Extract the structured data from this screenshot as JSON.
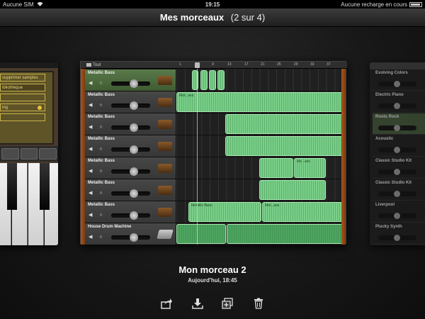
{
  "status_bar": {
    "carrier": "Aucune SIM",
    "time": "19:15",
    "charge": "Aucune recharge en cours"
  },
  "header": {
    "title": "Mes morceaux",
    "count": "(2 sur 4)"
  },
  "left_card": {
    "rows": [
      "supprimer samples",
      "ibliothèque",
      "",
      "ing"
    ]
  },
  "main_card": {
    "tout_label": "Tout",
    "ruler": [
      "1",
      "5",
      "9",
      "13",
      "17",
      "21",
      "25",
      "29",
      "33",
      "37"
    ],
    "tracks": [
      {
        "name": "Metallic Bass",
        "selected": true
      },
      {
        "name": "Metallic Bass",
        "selected": false,
        "region_label": "Met...ass"
      },
      {
        "name": "Metallic Bass",
        "selected": false
      },
      {
        "name": "Metallic Bass",
        "selected": false
      },
      {
        "name": "Metallic Bass",
        "selected": false,
        "region_label": "Me...ass"
      },
      {
        "name": "Metallic Bass",
        "selected": false
      },
      {
        "name": "Metallic Bass",
        "selected": false,
        "region_label": "Metallic Bass",
        "region_label2": "Met...ass"
      },
      {
        "name": "House Drum Machine",
        "selected": false
      }
    ]
  },
  "right_card": {
    "tracks": [
      "Evolving Colors",
      "Electric Piano",
      "Roots Rock",
      "Acoustic",
      "Classic Studio Kit",
      "Classic Studio Kit",
      "Liverpool",
      "Plucky Synth"
    ]
  },
  "song": {
    "title": "Mon morceau 2",
    "date": "Aujourd'hui, 18:45"
  },
  "actions": [
    "share-icon",
    "download-icon",
    "duplicate-icon",
    "trash-icon"
  ],
  "colors": {
    "region_green": "#7ad089",
    "selected_track": "#4f6c41",
    "wood_frame": "#a8551d"
  }
}
